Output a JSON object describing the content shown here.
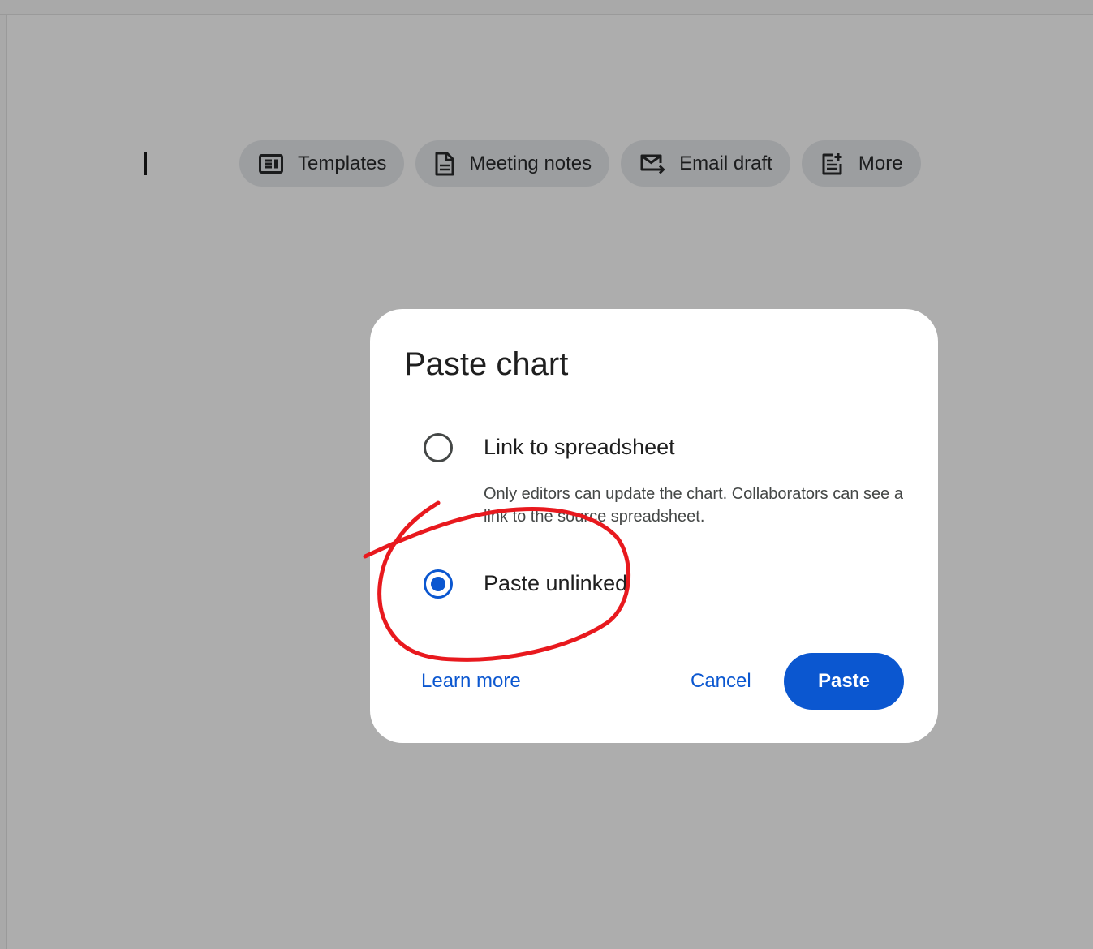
{
  "toolbar_chips": [
    {
      "label": "Templates",
      "icon": "templates-icon"
    },
    {
      "label": "Meeting notes",
      "icon": "document-icon"
    },
    {
      "label": "Email draft",
      "icon": "email-draft-icon"
    },
    {
      "label": "More",
      "icon": "more-notes-icon"
    }
  ],
  "dialog": {
    "title": "Paste chart",
    "options": [
      {
        "label": "Link to spreadsheet",
        "description": "Only editors can update the chart. Collaborators can see a link to the source spreadsheet.",
        "selected": false
      },
      {
        "label": "Paste unlinked",
        "selected": true
      }
    ],
    "learn_more": "Learn more",
    "cancel": "Cancel",
    "paste": "Paste"
  },
  "colors": {
    "accent": "#0b57d0",
    "backdrop": "#adadad",
    "chip_bg": "#9c9ea0",
    "annotation": "#e8191e"
  }
}
